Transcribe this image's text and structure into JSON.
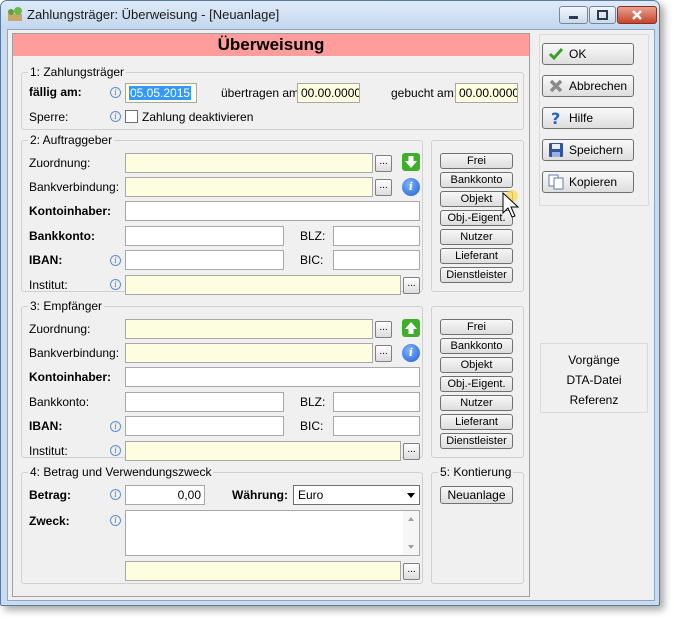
{
  "window": {
    "title": "Zahlungsträger: Überweisung - [Neuanlage]"
  },
  "form": {
    "header": "Überweisung",
    "g1": {
      "legend": "1: Zahlungsträger",
      "faellig_label": "fällig am:",
      "faellig_value": "05.05.2015",
      "uebertragen_label": "übertragen am:",
      "uebertragen_value": "00.00.0000",
      "gebucht_label": "gebucht am:",
      "gebucht_value": "00.00.0000",
      "sperre_label": "Sperre:",
      "deaktivieren_label": "Zahlung deaktivieren"
    },
    "g2": {
      "legend": "2: Auftraggeber",
      "zuordnung": "Zuordnung:",
      "bankverbindung": "Bankverbindung:",
      "kontoinhaber": "Kontoinhaber:",
      "bankkonto": "Bankkonto:",
      "blz": "BLZ:",
      "iban": "IBAN:",
      "bic": "BIC:",
      "institut": "Institut:"
    },
    "g3": {
      "legend": "3: Empfänger",
      "zuordnung": "Zuordnung:",
      "bankverbindung": "Bankverbindung:",
      "kontoinhaber": "Kontoinhaber:",
      "bankkonto": "Bankkonto:",
      "blz": "BLZ:",
      "iban": "IBAN:",
      "bic": "BIC:",
      "institut": "Institut:"
    },
    "side_buttons": [
      "Frei",
      "Bankkonto",
      "Objekt",
      "Obj.-Eigent.",
      "Nutzer",
      "Lieferant",
      "Dienstleister"
    ],
    "g4": {
      "legend": "4: Betrag und Verwendungszweck",
      "betrag_label": "Betrag:",
      "betrag_value": "0,00",
      "waehrung_label": "Währung:",
      "waehrung_value": "Euro",
      "zweck_label": "Zweck:"
    },
    "g5": {
      "legend": "5: Kontierung",
      "neuanlage": "Neuanlage"
    }
  },
  "actions": {
    "ok": "OK",
    "abbrechen": "Abbrechen",
    "hilfe": "Hilfe",
    "speichern": "Speichern",
    "kopieren": "Kopieren"
  },
  "links": {
    "vorgaenge": "Vorgänge",
    "dta": "DTA-Datei",
    "referenz": "Referenz"
  },
  "colors": {
    "header_bg": "#ff9c9c",
    "field_yellow": "#fdfde0",
    "selection": "#3399ff"
  }
}
